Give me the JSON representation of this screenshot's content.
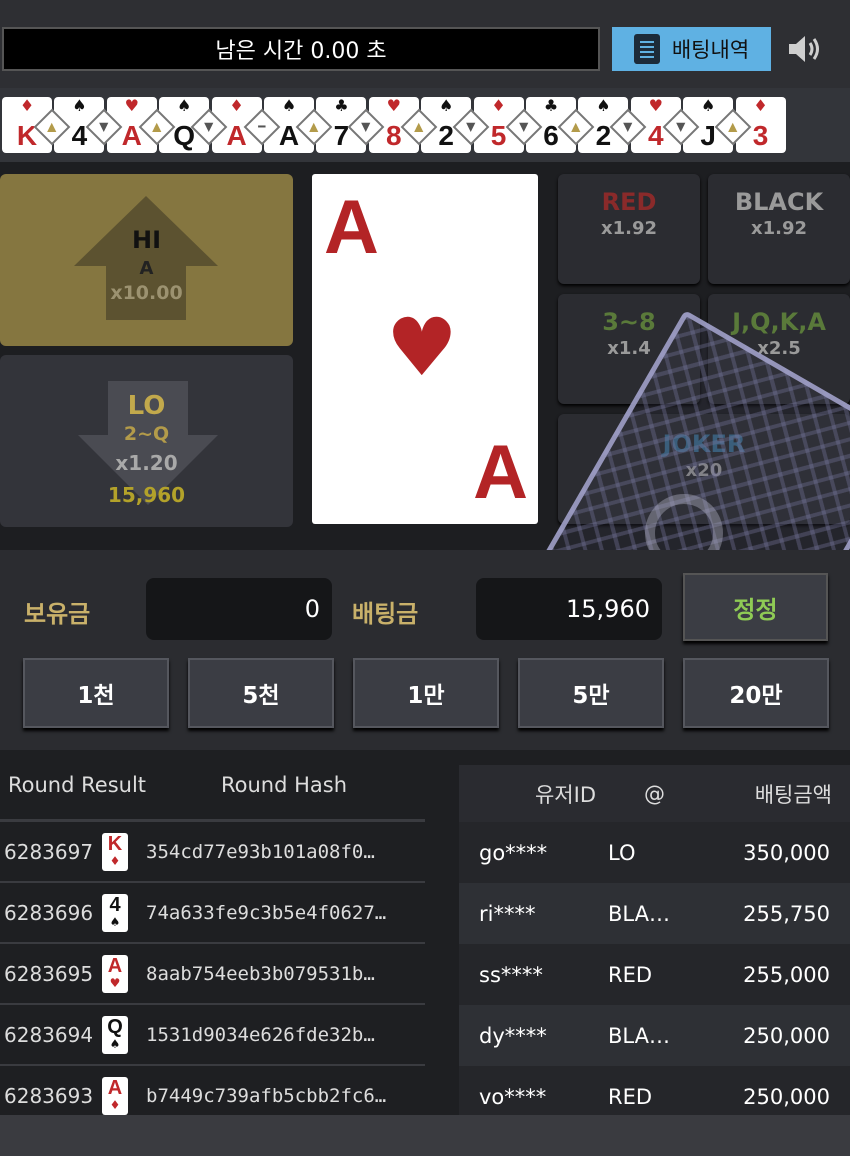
{
  "header": {
    "timer_text": "남은 시간 0.00 초",
    "history_label": "배팅내역"
  },
  "strip": {
    "cards": [
      {
        "rank": "K",
        "suit": "♦",
        "color": "#c0282b"
      },
      {
        "rank": "4",
        "suit": "♠",
        "color": "#111111"
      },
      {
        "rank": "A",
        "suit": "♥",
        "color": "#c0282b"
      },
      {
        "rank": "Q",
        "suit": "♠",
        "color": "#111111"
      },
      {
        "rank": "A",
        "suit": "♦",
        "color": "#c0282b"
      },
      {
        "rank": "A",
        "suit": "♠",
        "color": "#111111"
      },
      {
        "rank": "7",
        "suit": "♣",
        "color": "#111111"
      },
      {
        "rank": "8",
        "suit": "♥",
        "color": "#c0282b"
      },
      {
        "rank": "2",
        "suit": "♠",
        "color": "#111111"
      },
      {
        "rank": "5",
        "suit": "♦",
        "color": "#c0282b"
      },
      {
        "rank": "6",
        "suit": "♣",
        "color": "#111111"
      },
      {
        "rank": "2",
        "suit": "♠",
        "color": "#111111"
      },
      {
        "rank": "4",
        "suit": "♥",
        "color": "#c0282b"
      },
      {
        "rank": "J",
        "suit": "♠",
        "color": "#111111"
      },
      {
        "rank": "3",
        "suit": "♦",
        "color": "#c0282b"
      }
    ],
    "markers": [
      "up",
      "down",
      "up",
      "down",
      "same",
      "up",
      "down",
      "up",
      "down",
      "down",
      "up",
      "down",
      "down",
      "up"
    ]
  },
  "play": {
    "hi": {
      "label": "HI",
      "sub": "A",
      "odds": "x10.00"
    },
    "lo": {
      "label": "LO",
      "sub": "2~Q",
      "odds": "x1.20",
      "amount": "15,960"
    },
    "current_card": {
      "rank": "A",
      "suit": "♥"
    },
    "side_bets": [
      {
        "label": "RED",
        "odds": "x1.92",
        "color": "#8a2a2a"
      },
      {
        "label": "BLACK",
        "odds": "x1.92",
        "color": "#9a9a9a"
      },
      {
        "label": "3~8",
        "odds": "x1.4",
        "color": "#5a7a3a"
      },
      {
        "label": "J,Q,K,A",
        "odds": "x2.5",
        "color": "#5a7a3a"
      },
      {
        "label": "JOKER",
        "odds": "x20",
        "color": "#3a6a8a"
      }
    ]
  },
  "bet": {
    "balance_label": "보유금",
    "balance_value": "0",
    "bet_label": "배팅금",
    "bet_value": "15,960",
    "correct_label": "정정",
    "chips": [
      "1천",
      "5천",
      "1만",
      "5만",
      "20만"
    ]
  },
  "results": {
    "headers": {
      "round": "Round Result",
      "hash": "Round Hash"
    },
    "rows": [
      {
        "id": "6283697",
        "rank": "K",
        "suit": "♦",
        "color": "#c0282b",
        "hash": "354cd77e93b101a08f0…"
      },
      {
        "id": "6283696",
        "rank": "4",
        "suit": "♠",
        "color": "#111111",
        "hash": "74a633fe9c3b5e4f0627…"
      },
      {
        "id": "6283695",
        "rank": "A",
        "suit": "♥",
        "color": "#c0282b",
        "hash": "8aab754eeb3b079531b…"
      },
      {
        "id": "6283694",
        "rank": "Q",
        "suit": "♠",
        "color": "#111111",
        "hash": "1531d9034e626fde32b…"
      },
      {
        "id": "6283693",
        "rank": "A",
        "suit": "♦",
        "color": "#c0282b",
        "hash": "b7449c739afb5cbb2fc6…"
      }
    ]
  },
  "user_bets": {
    "headers": {
      "user": "유저ID",
      "pick": "@",
      "amount": "배팅금액"
    },
    "rows": [
      {
        "user": "go****",
        "pick": "LO",
        "amount": "350,000"
      },
      {
        "user": "ri****",
        "pick": "BLA…",
        "amount": "255,750"
      },
      {
        "user": "ss****",
        "pick": "RED",
        "amount": "255,000"
      },
      {
        "user": "dy****",
        "pick": "BLA…",
        "amount": "250,000"
      },
      {
        "user": "vo****",
        "pick": "RED",
        "amount": "250,000"
      }
    ]
  }
}
